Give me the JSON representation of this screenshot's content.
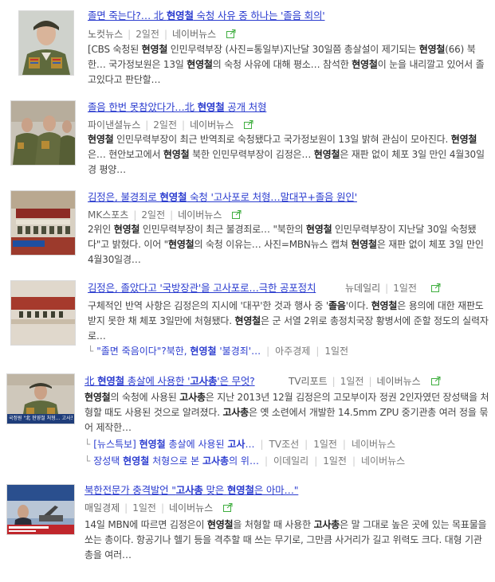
{
  "articles": [
    {
      "title_parts": [
        "졸면 죽는다?… 北 ",
        "현영철",
        " 숙청 사유 중 하나는 '졸음 회의'"
      ],
      "source": "노컷뉴스",
      "date": "2일전",
      "naver": "네이버뉴스",
      "desc_parts": [
        "[CBS 숙청된 ",
        "현영철",
        " 인민무력부장 (사진=통일부)지난달 30일쯤 총살설이 제기되는 ",
        "현영철",
        "(66) 북한… 국가정보원은 13일 ",
        "현영철",
        "의 숙청 사유에 대해 평소… 참석한 ",
        "현영철",
        "이 눈을 내리깔고 있어서 졸고있다고 판단할…"
      ]
    },
    {
      "title_parts": [
        "졸음 한번 못참았다가…北 ",
        "현영철",
        " 공개 처형"
      ],
      "source": "파이낸셜뉴스",
      "date": "2일전",
      "naver": "네이버뉴스",
      "desc_parts": [
        "",
        "현영철",
        " 인민무력부장이 최근 반역죄로 숙청됐다고 국가정보원이 13일 밝혀 관심이 모아진다. ",
        "현영철",
        "은… 현안보고에서 ",
        "현영철",
        " 북한 인민무력부장이 김정은… ",
        "현영철",
        "은 재판 없이 체포 3일 만인 4월30일경 평양…"
      ]
    },
    {
      "title_parts": [
        "김정은, 불경죄로 ",
        "현영철",
        " 숙청 '고사포로 처형…말대꾸+졸음 원인'"
      ],
      "source": "MK스포츠",
      "date": "2일전",
      "naver": "네이버뉴스",
      "desc_parts": [
        "2위인 ",
        "현영철",
        " 인민무력부장이 최근 불경죄로… \"북한의 ",
        "현영철",
        " 인민무력부장이 지난달 30일 숙청됐다\"고 밝혔다. 이어 \"",
        "현영철",
        "의 숙청 이유는… 사진=MBN뉴스 캡쳐 ",
        "현영철",
        "은 재판 없이 체포 3일 만인 4월30일경…"
      ]
    },
    {
      "title_parts": [
        "김정은, 졸았다고 '국방장관'을 고사포로…극한 공포정치"
      ],
      "source": "뉴데일리",
      "date": "1일전",
      "desc_parts": [
        "구체적인 반역 사항은 김정은의 지시에 '대꾸'한 것과 행사 중 '",
        "졸음",
        "'이다. ",
        "현영철",
        "은 용의에 대한 재판도 받지 못한 채 체포 3일만에 처형됐다. ",
        "현영철",
        "은 군 서열 2위로 총정치국장 황병서에 준할 정도의 실력자로…"
      ],
      "related": [
        {
          "title_parts": [
            "\"졸면 죽음이다\"?북한, ",
            "현영철",
            " '불경죄'…"
          ],
          "source": "아주경제",
          "date": "1일전"
        }
      ]
    },
    {
      "title_parts": [
        "北 ",
        "현영철",
        " 총살에 사용한 '",
        "고사총",
        "'은 무엇?"
      ],
      "source": "TV리포트",
      "date": "1일전",
      "naver": "네이버뉴스",
      "desc_parts": [
        "",
        "현영철",
        "의 숙청에 사용된 ",
        "고사총",
        "은 지난 2013년 12월 김정은의 고모부이자 정권 2인자였던 장성택을 처형할 때도 사용된 것으로 알려졌다. ",
        "고사총",
        "은 옛 소련에서 개발한 14.5mm ZPU 중기관총 여러 정을 묶어 제작한…"
      ],
      "thumb_caption": "국정원 \"北 현영철 처형… 고사포 사용\"",
      "related": [
        {
          "title_parts": [
            "[뉴스특보] ",
            "현영철",
            " 총살에 사용된 ",
            "고사",
            "…"
          ],
          "source": "TV조선",
          "date": "1일전",
          "naver": "네이버뉴스"
        },
        {
          "title_parts": [
            "장성택 ",
            "현영철",
            " 처형으로 본 ",
            "고사총",
            "의 위…"
          ],
          "source": "이데일리",
          "date": "1일전",
          "naver": "네이버뉴스"
        }
      ]
    },
    {
      "title_parts": [
        "북한전문가 충격발언 \"",
        "고사총",
        " 맞은 ",
        "현영철",
        "은 아마…\""
      ],
      "source": "매일경제",
      "date": "1일전",
      "naver": "네이버뉴스",
      "desc_parts": [
        "14일 MBN에 따르면 김정은이 ",
        "현영철",
        "을 처형할 때 사용한 ",
        "고사총",
        "은 말 그대로 높은 곳에 있는 목표물을 쏘는 총이다. 항공기나 헬기 등을 격추할 때 쓰는 무기로, 그만큼 사거리가 길고 위력도 크다. 대형 기관총을 여러…"
      ]
    }
  ]
}
